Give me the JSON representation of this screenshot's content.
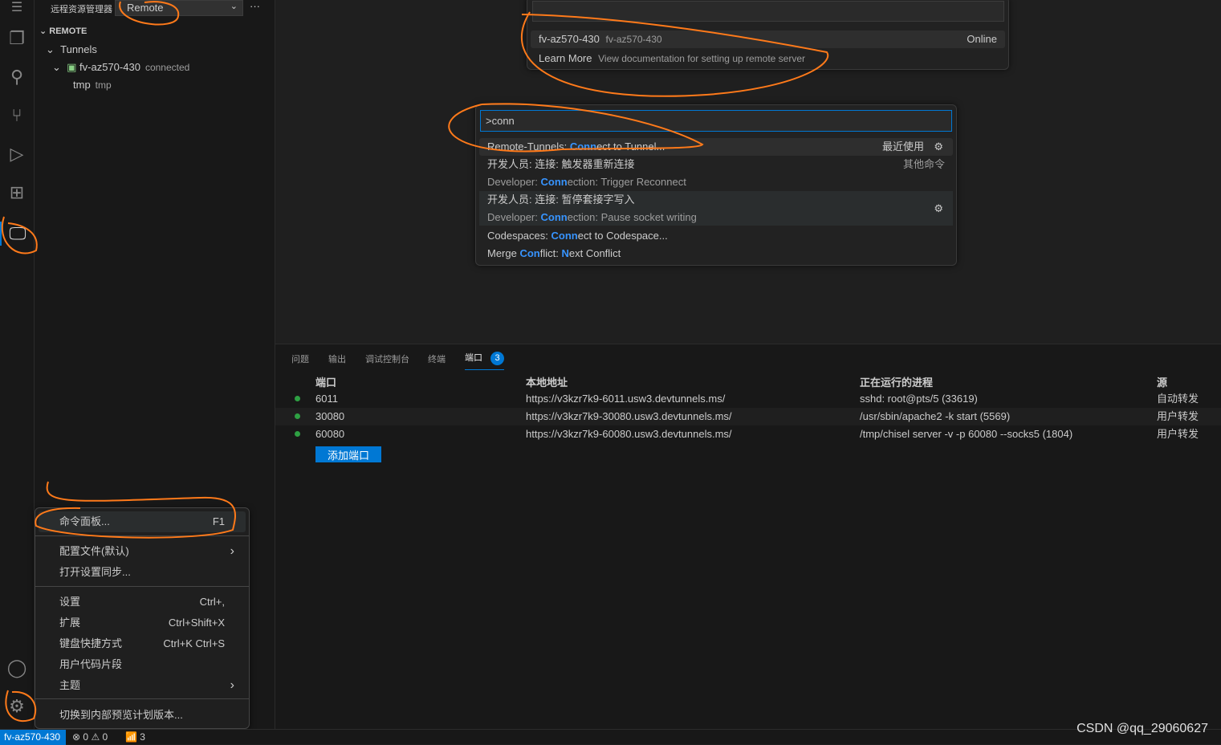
{
  "sidebar": {
    "title": "远程资源管理器",
    "select_value": "Remote",
    "section": "REMOTE",
    "tunnels": "Tunnels",
    "host": "fv-az570-430",
    "host_status": "connected",
    "folder": "tmp",
    "folder_desc": "tmp"
  },
  "quickpick_top": {
    "item_name": "fv-az570-430",
    "item_desc": "fv-az570-430",
    "item_status": "Online",
    "learn_more": "Learn More",
    "learn_desc": "View documentation for setting up remote server"
  },
  "command_palette": {
    "input": ">conn",
    "recent_label": "最近使用",
    "other_label": "其他命令",
    "items": [
      {
        "parts": [
          {
            "t": "Remote-Tunnels: "
          },
          {
            "t": "Conn",
            "h": 1
          },
          {
            "t": "ect to Tunnel..."
          }
        ]
      },
      {
        "parts": [
          {
            "t": "开发人员: 连接: 触发器重新连接"
          }
        ],
        "sub": [
          {
            "t": "Developer: "
          },
          {
            "t": "Conn",
            "h": 1
          },
          {
            "t": "ection: Trigger Reconnect"
          }
        ]
      },
      {
        "parts": [
          {
            "t": "开发人员: 连接: 暂停套接字写入"
          }
        ],
        "sub": [
          {
            "t": "Developer: "
          },
          {
            "t": "Conn",
            "h": 1
          },
          {
            "t": "ection: Pause socket writing"
          }
        ]
      },
      {
        "parts": [
          {
            "t": "Codespaces: "
          },
          {
            "t": "Conn",
            "h": 1
          },
          {
            "t": "ect to Codespace..."
          }
        ]
      },
      {
        "parts": [
          {
            "t": "Merge "
          },
          {
            "t": "Con",
            "h": 1
          },
          {
            "t": "flict: "
          },
          {
            "t": "N",
            "h": 1
          },
          {
            "t": "ext Conflict"
          }
        ]
      }
    ]
  },
  "panel": {
    "tabs": [
      "问题",
      "输出",
      "调试控制台",
      "终端",
      "端口"
    ],
    "ports_badge": "3",
    "headers": [
      "端口",
      "本地地址",
      "正在运行的进程",
      "源"
    ],
    "rows": [
      [
        "6011",
        "https://v3kzr7k9-6011.usw3.devtunnels.ms/",
        "sshd: root@pts/5 (33619)",
        "自动转发"
      ],
      [
        "30080",
        "https://v3kzr7k9-30080.usw3.devtunnels.ms/",
        "/usr/sbin/apache2 -k start (5569)",
        "用户转发"
      ],
      [
        "60080",
        "https://v3kzr7k9-60080.usw3.devtunnels.ms/",
        "/tmp/chisel server -v -p 60080 --socks5 (1804)",
        "用户转发"
      ]
    ],
    "add_port": "添加端口"
  },
  "menu": {
    "items": [
      {
        "label": "命令面板...",
        "key": "F1"
      },
      {
        "label": "配置文件(默认)",
        "key": ""
      },
      {
        "label": "打开设置同步...",
        "key": ""
      },
      {
        "label": "设置",
        "key": "Ctrl+,"
      },
      {
        "label": "扩展",
        "key": "Ctrl+Shift+X"
      },
      {
        "label": "键盘快捷方式",
        "key": "Ctrl+K Ctrl+S"
      },
      {
        "label": "用户代码片段",
        "key": ""
      },
      {
        "label": "主题",
        "key": ""
      },
      {
        "label": "切换到内部预览计划版本...",
        "key": ""
      }
    ]
  },
  "status": {
    "remote": "fv-az570-430",
    "errors": "0",
    "warnings": "0",
    "ports": "3"
  },
  "watermark": "CSDN @qq_29060627"
}
